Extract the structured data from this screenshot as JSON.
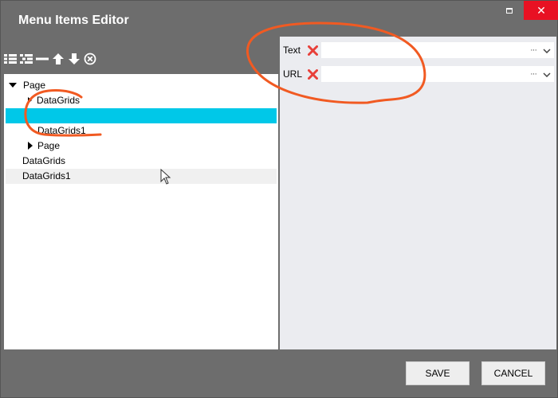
{
  "window": {
    "title": "Menu Items Editor",
    "close_glyph": "✕"
  },
  "toolbar": {
    "buttons": [
      {
        "name": "add-item-icon"
      },
      {
        "name": "add-child-item-icon"
      },
      {
        "name": "remove-item-icon"
      },
      {
        "name": "move-up-icon"
      },
      {
        "name": "move-down-icon"
      },
      {
        "name": "clear-icon"
      }
    ]
  },
  "tree": {
    "items": [
      {
        "label": "Page",
        "expanded": true
      },
      {
        "label": "DataGrids",
        "collapsed": true
      },
      {
        "label": "",
        "selected": true
      },
      {
        "label": "DataGrids1"
      },
      {
        "label": "Page",
        "collapsed": true
      },
      {
        "label": "DataGrids"
      },
      {
        "label": "DataGrids1"
      }
    ]
  },
  "properties": {
    "rows": [
      {
        "label": "Text",
        "value": "",
        "dots": "···"
      },
      {
        "label": "URL",
        "value": "",
        "dots": "···"
      }
    ]
  },
  "footer": {
    "save_label": "SAVE",
    "cancel_label": "CANCEL"
  },
  "colors": {
    "selected_row": "#00c8e8",
    "annotation": "#f15a22",
    "remove_x": "#e8403a",
    "window_bg": "#6d6d6d"
  }
}
